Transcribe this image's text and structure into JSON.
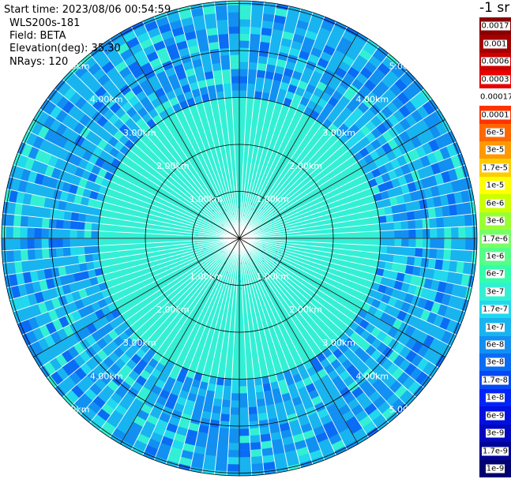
{
  "header": {
    "start_time": "Start time: 2023/08/06 00:54:59",
    "instrument": "WLS200s-181",
    "field": "Field: BETA",
    "elevation": "Elevation(deg): 35.30",
    "nrays": "NRays: 120"
  },
  "ppi": {
    "range_labels": [
      "1.00km",
      "2.00km",
      "3.00km",
      "4.00km",
      "5.00km"
    ],
    "range_km": [
      1,
      2,
      3,
      4,
      5
    ],
    "n_rays": 120,
    "colors": {
      "background": "#ffffff",
      "grid": "#000000",
      "label": "#ffffff",
      "inner_fill": "#33f0d5",
      "outer_fill": "#18b4f0"
    }
  },
  "colorbar": {
    "title": "-1 sr",
    "items": [
      {
        "label": "0.0017",
        "color": "#8a0000"
      },
      {
        "label": "0.001",
        "color": "#a40000"
      },
      {
        "label": "0.0006",
        "color": "#cc0000"
      },
      {
        "label": "0.0003",
        "color": "#e80000"
      },
      {
        "label": "0.00017",
        "color": "#ffffff"
      },
      {
        "label": "0.0001",
        "color": "#ff3300"
      },
      {
        "label": "6e-5",
        "color": "#ff6600"
      },
      {
        "label": "3e-5",
        "color": "#ff9900"
      },
      {
        "label": "1.7e-5",
        "color": "#ffcc00"
      },
      {
        "label": "1e-5",
        "color": "#ffff00"
      },
      {
        "label": "6e-6",
        "color": "#ccff00"
      },
      {
        "label": "3e-6",
        "color": "#99ff33"
      },
      {
        "label": "1.7e-6",
        "color": "#77ff66"
      },
      {
        "label": "1e-6",
        "color": "#55ff88"
      },
      {
        "label": "6e-7",
        "color": "#33ffaa"
      },
      {
        "label": "3e-7",
        "color": "#33f0d5"
      },
      {
        "label": "1.7e-7",
        "color": "#22d8ee"
      },
      {
        "label": "1e-7",
        "color": "#18b4f0"
      },
      {
        "label": "6e-8",
        "color": "#1190f2"
      },
      {
        "label": "3e-8",
        "color": "#0a6cf4"
      },
      {
        "label": "1.7e-8",
        "color": "#0548f6"
      },
      {
        "label": "1e-8",
        "color": "#0024f8"
      },
      {
        "label": "6e-9",
        "color": "#0010e0"
      },
      {
        "label": "3e-9",
        "color": "#0008c0"
      },
      {
        "label": "1.7e-9",
        "color": "#000494"
      },
      {
        "label": "1e-9",
        "color": "#000070"
      }
    ]
  }
}
